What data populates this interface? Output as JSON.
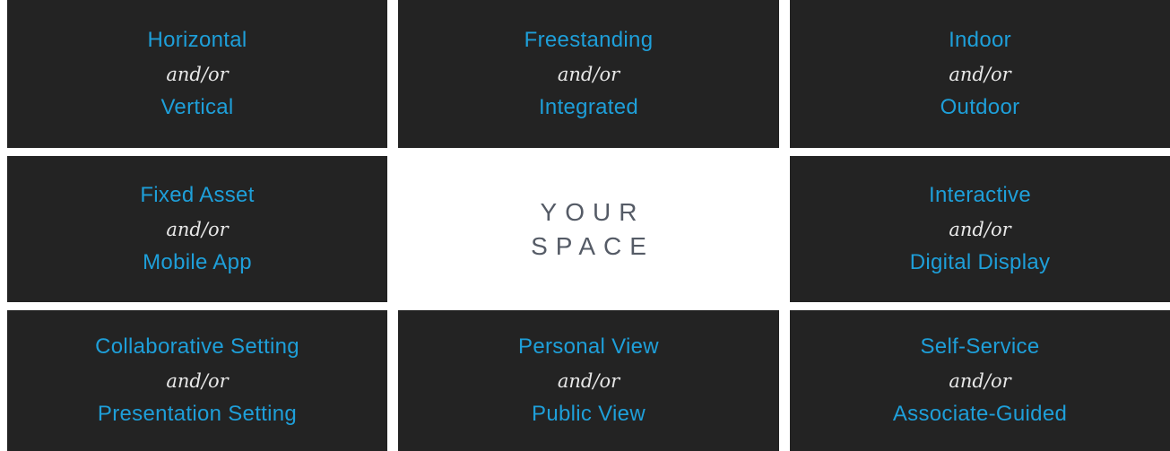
{
  "tiles": [
    {
      "a": "Horizontal",
      "conn": "and/or",
      "b": "Vertical"
    },
    {
      "a": "Freestanding",
      "conn": "and/or",
      "b": "Integrated"
    },
    {
      "a": "Indoor",
      "conn": "and/or",
      "b": "Outdoor"
    },
    {
      "a": "Fixed Asset",
      "conn": "and/or",
      "b": "Mobile App"
    },
    {
      "a": "Interactive",
      "conn": "and/or",
      "b": "Digital Display"
    },
    {
      "a": "Collaborative Setting",
      "conn": "and/or",
      "b": "Presentation Setting"
    },
    {
      "a": "Personal View",
      "conn": "and/or",
      "b": "Public View"
    },
    {
      "a": "Self-Service",
      "conn": "and/or",
      "b": "Associate-Guided"
    }
  ],
  "center": {
    "line1": "YOUR",
    "line2": "SPACE"
  },
  "colors": {
    "tile_bg": "#232323",
    "accent": "#1e9fd9",
    "connector": "#e8e8e8",
    "center_text": "#555b66"
  }
}
